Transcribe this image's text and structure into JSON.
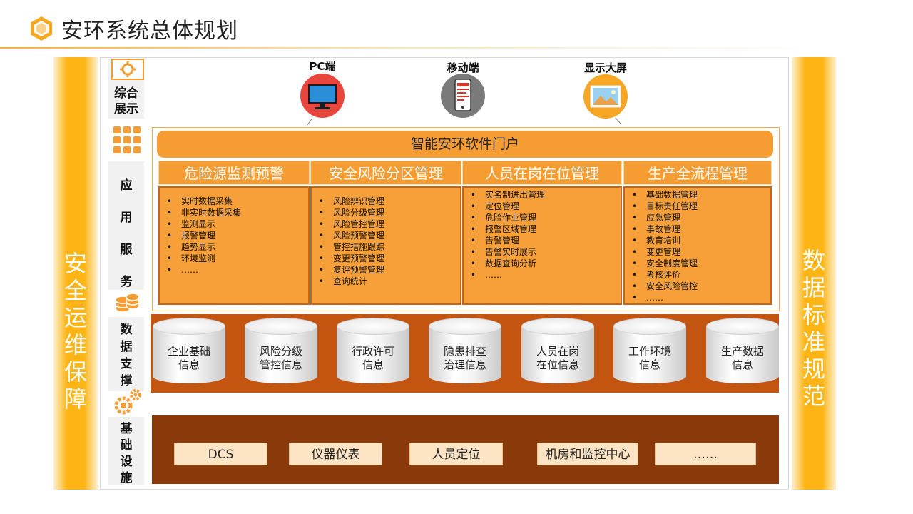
{
  "title": "安环系统总体规划",
  "side_left": [
    "安",
    "全",
    "运",
    "维",
    "保",
    "障"
  ],
  "side_right": [
    "数",
    "据",
    "标",
    "准",
    "规",
    "范"
  ],
  "layers": {
    "display": [
      "综合",
      "展示"
    ],
    "app": [
      "应",
      "用",
      "服",
      "务"
    ],
    "data": [
      "数",
      "据",
      "支",
      "撑"
    ],
    "infra": [
      "基",
      "础",
      "设",
      "施"
    ]
  },
  "devices": [
    {
      "label": "PC端",
      "icon": "monitor-icon",
      "color": "#e8453c"
    },
    {
      "label": "移动端",
      "icon": "mobile-phone-icon",
      "color": "#7a7a7a"
    },
    {
      "label": "显示大屏",
      "icon": "large-screen-icon",
      "color": "#f6a623"
    }
  ],
  "portal": "智能安环软件门户",
  "modules": [
    {
      "name": "危险源监测预警",
      "items": [
        "实时数据采集",
        "非实时数据采集",
        "监测显示",
        "报警管理",
        "趋势显示",
        "环境监测",
        "……"
      ]
    },
    {
      "name": "安全风险分区管理",
      "items": [
        "风险辨识管理",
        "风险分级管理",
        "风险管控管理",
        "风险预警管理",
        "管控措施跟踪",
        "变更预警管理",
        "复评预警管理",
        "查询统计"
      ]
    },
    {
      "name": "人员在岗在位管理",
      "items": [
        "实名制进出管理",
        "定位管理",
        "危险作业管理",
        "报警区域管理",
        "告警管理",
        "告警实时展示",
        "数据查询分析",
        "……"
      ]
    },
    {
      "name": "生产全流程管理",
      "items": [
        "基础数据管理",
        "目标责任管理",
        "应急管理",
        "事故管理",
        "教育培训",
        "变更管理",
        "安全制度管理",
        "考核评价",
        "安全风险管控",
        "……"
      ]
    }
  ],
  "databases": [
    [
      "企业基础",
      "信息"
    ],
    [
      "风险分级",
      "管控信息"
    ],
    [
      "行政许可",
      "信息"
    ],
    [
      "隐患排查",
      "治理信息"
    ],
    [
      "人员在岗",
      "在位信息"
    ],
    [
      "工作环境",
      "信息"
    ],
    [
      "生产数据",
      "信息"
    ]
  ],
  "infrastructure": [
    "DCS",
    "仪器仪表",
    "人员定位",
    "机房和监控中心",
    "……"
  ],
  "colors": {
    "accent": "#f59d33",
    "side": "#fdb516",
    "data_band": "#c45510",
    "infra_band": "#8a3a0a"
  }
}
